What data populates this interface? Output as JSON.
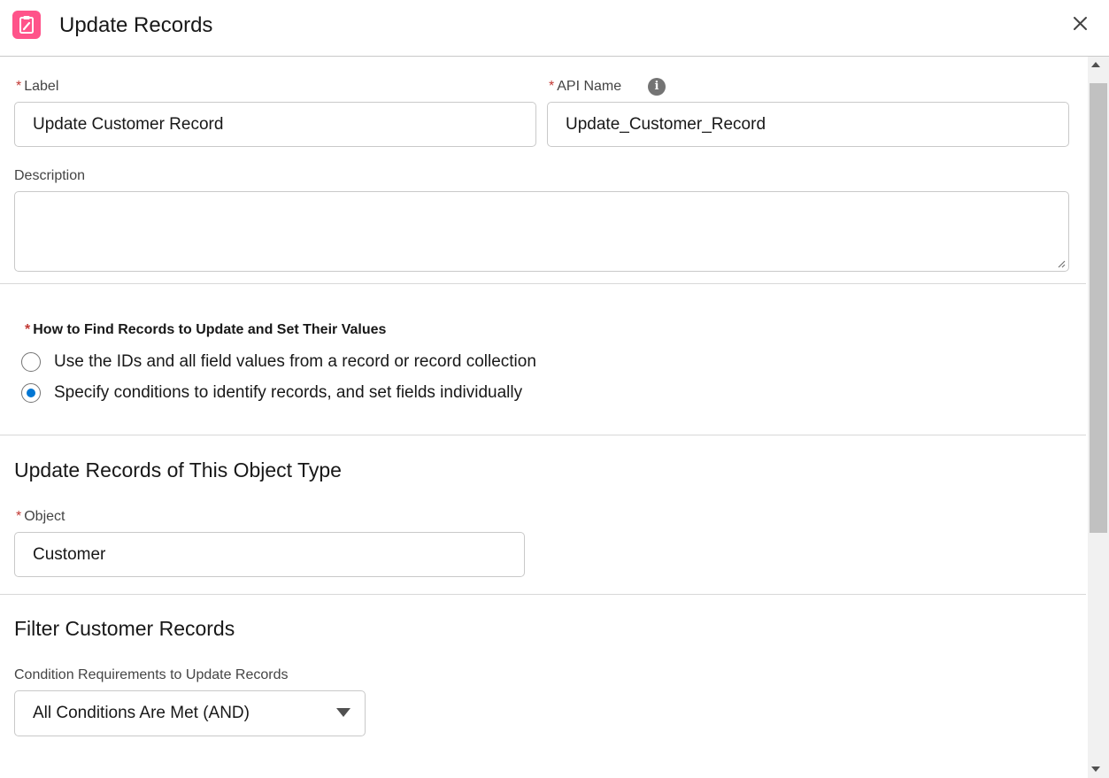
{
  "header": {
    "title": "Update Records",
    "icon": "clipboard-edit-icon",
    "accent_color": "#ff538a",
    "close_icon": "close-icon"
  },
  "form": {
    "required_mark": "*",
    "label_field": {
      "label": "Label",
      "value": "Update Customer Record"
    },
    "api_name_field": {
      "label": "API Name",
      "value": "Update_Customer_Record",
      "info_icon": "info-icon",
      "info_glyph": "i"
    },
    "description_field": {
      "label": "Description",
      "value": ""
    }
  },
  "find_records": {
    "heading": "How to Find Records to Update and Set Their Values",
    "options": [
      {
        "label": "Use the IDs and all field values from a record or record collection",
        "selected": false
      },
      {
        "label": "Specify conditions to identify records, and set fields individually",
        "selected": true
      }
    ],
    "radio_color": "#0176d3"
  },
  "object_section": {
    "title": "Update Records of This Object Type",
    "object_label": "Object",
    "object_value": "Customer"
  },
  "filter_section": {
    "title": "Filter Customer Records",
    "condition_label": "Condition Requirements to Update Records",
    "condition_value": "All Conditions Are Met (AND)"
  }
}
